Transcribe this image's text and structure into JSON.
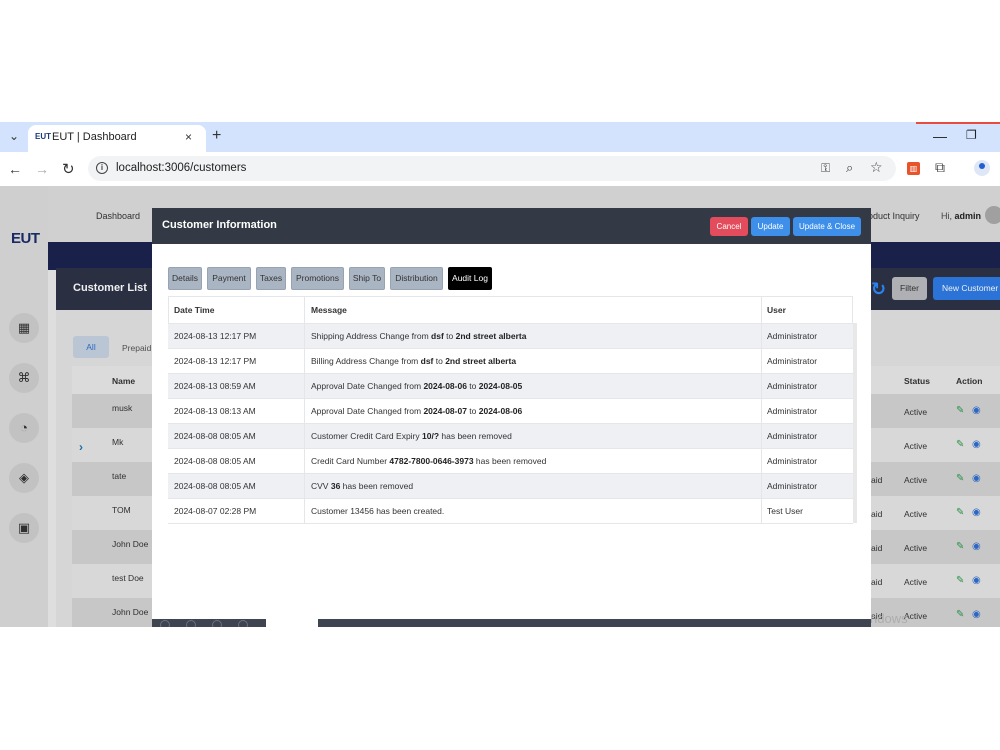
{
  "browser": {
    "tab_title": "EUT | Dashboard",
    "favicon_text": "EUT",
    "url": "localhost:3006/customers",
    "new_tab_label": "+",
    "close_tab_label": "×"
  },
  "app": {
    "logo": "EUT",
    "top_nav": {
      "dashboard": "Dashboard",
      "product_inquiry": "oduct Inquiry",
      "greeting": "Hi,",
      "user": "admin"
    },
    "list": {
      "title": "Customer List",
      "filter_label": "Filter",
      "new_customer_label": "New Customer",
      "tabs": [
        "All",
        "Prepaid"
      ],
      "columns": {
        "name": "Name",
        "status": "Status",
        "action": "Action"
      },
      "rows": [
        {
          "name": "musk",
          "status": "Active",
          "tag": ""
        },
        {
          "name": "Mk",
          "status": "Active",
          "tag": ""
        },
        {
          "name": "tate",
          "status": "Active",
          "tag": "aid"
        },
        {
          "name": "TOM",
          "status": "Active",
          "tag": "aid"
        },
        {
          "name": "John Doe",
          "status": "Active",
          "tag": "aid"
        },
        {
          "name": "test Doe",
          "status": "Active",
          "tag": "aid"
        },
        {
          "name": "John Doe",
          "status": "Active",
          "tag": "aid"
        }
      ]
    },
    "watermark": "Activate Windows"
  },
  "modal": {
    "title": "Customer Information",
    "buttons": {
      "cancel": "Cancel",
      "update": "Update",
      "update_close": "Update & Close"
    },
    "tabs": [
      "Details",
      "Payment",
      "Taxes",
      "Promotions",
      "Ship To",
      "Distribution",
      "Audit Log"
    ],
    "active_tab": "Audit Log",
    "audit": {
      "headers": {
        "datetime": "Date Time",
        "message": "Message",
        "user": "User"
      },
      "rows": [
        {
          "datetime": "2024-08-13 12:17 PM",
          "parts": [
            "Shipping Address Change from ",
            "dsf",
            " to ",
            "2nd street alberta",
            ""
          ],
          "user": "Administrator"
        },
        {
          "datetime": "2024-08-13 12:17 PM",
          "parts": [
            "Billing Address Change from ",
            "dsf",
            " to ",
            "2nd street alberta",
            ""
          ],
          "user": "Administrator"
        },
        {
          "datetime": "2024-08-13 08:59 AM",
          "parts": [
            "Approval Date Changed from ",
            "2024-08-06",
            " to ",
            "2024-08-05",
            ""
          ],
          "user": "Administrator"
        },
        {
          "datetime": "2024-08-13 08:13 AM",
          "parts": [
            "Approval Date Changed from ",
            "2024-08-07",
            " to ",
            "2024-08-06",
            ""
          ],
          "user": "Administrator"
        },
        {
          "datetime": "2024-08-08 08:05 AM",
          "parts": [
            "Customer Credit Card Expiry ",
            "10/?",
            " has been removed",
            "",
            ""
          ],
          "user": "Administrator"
        },
        {
          "datetime": "2024-08-08 08:05 AM",
          "parts": [
            "Credit Card Number ",
            "4782-7800-0646-3973",
            " has been removed",
            "",
            ""
          ],
          "user": "Administrator"
        },
        {
          "datetime": "2024-08-08 08:05 AM",
          "parts": [
            "CVV ",
            "36",
            " has been removed",
            "",
            ""
          ],
          "user": "Administrator"
        },
        {
          "datetime": "2024-08-07 02:28 PM",
          "parts": [
            "Customer 13456 has been created.",
            "",
            "",
            "",
            ""
          ],
          "user": "Test User"
        }
      ]
    }
  },
  "colors": {
    "modal_header": "#343a45",
    "cancel": "#e24c5c",
    "update": "#3d8fea",
    "active_tab": "#000000",
    "row_alt": "#eef0f4"
  }
}
